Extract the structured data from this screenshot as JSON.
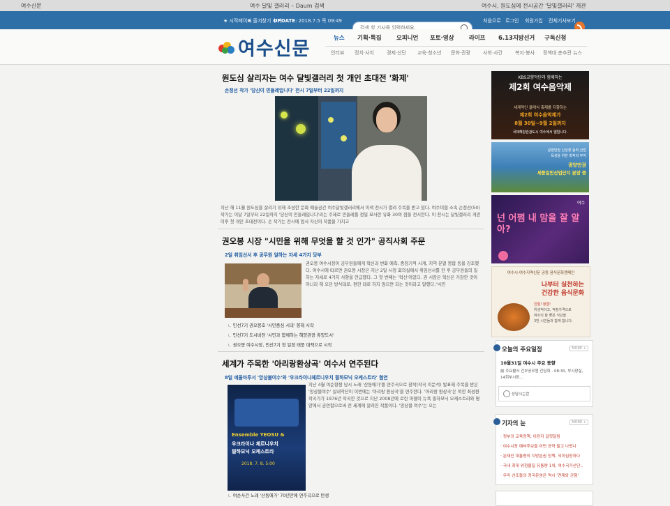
{
  "browser": {
    "tabs": [
      "여수신문",
      "여수 달빛 갤러리 – Daum 검색",
      "여수시, 원도심에 전시공간 '달빛갤러리' 개관"
    ]
  },
  "topbar": {
    "start_page": "시작페이지",
    "bookmark": "즐겨찾기 추가",
    "update_label": "UPDATE",
    "update_value": ": 2018.7.5 목 09:49",
    "search_placeholder": "검색 할 기사를 입력하세요.",
    "links": [
      "처음으로",
      "로그인",
      "회원가입",
      "전체기사보기"
    ]
  },
  "site": {
    "logo_text": "여수신문",
    "nav_main": [
      "뉴스",
      "기획·특집",
      "오피니언",
      "포토·영상",
      "라이프",
      "6.13지방선거",
      "구독신청"
    ],
    "nav_sub": [
      "인터뷰",
      "정치·사치",
      "경제·산단",
      "교육·청소년",
      "문화·관광",
      "사회·사건",
      "복지·봉사",
      "정책대 춘추관 뉴스"
    ]
  },
  "articles": [
    {
      "headline": "원도심 살리자는 여수 달빛갤러리 첫 개인 초대전 '화제'",
      "subhead": "손정선 작가 '당신이 민들레입니다' 전시 7일부터 22일까지",
      "body": "지난 해 11월 원도심을 살리기 위해 조성한 문화 예술공간 여수달빛갤러리에서 이색 전시가 열려 주목을 받고 있다. 여수미협 소속 손정선(50) 작가는 이달 7일부터 22일까지 '당신이 민들레입니다'라는 주제로 민들레를 정밀 묘사한 유화 30여 점을 전시한다. 이 전시는 달빛갤러리 개관 이후 첫 개인 초대전이다. 손 작가는 전시에 앞서 자신의 작품을 가지고"
    },
    {
      "headline": "권오봉 시장 \"시민을 위해 무엇을 할 것 인가\" 공직사회 주문",
      "subhead": "2일 취임선서 후 공무원 일하는 자세 4가지 당부",
      "body": "권오봉 여수시장이 공무원들에게 혁신과 변화 예측, 중장기적 시계, 지역 분열 봉합 등을 강조했다. 여수시에 따르면 권오봉 시장은 지난 2일 시청 회의실에서 취임선서를 한 후 공무원들의 일하는 자세로 4가지 사항을 언급했다. 그 첫 번째는 '혁신'이었다. 권 시장은 혁신은 거창한 것이 아니라 해 오던 방식대로, 편한 대로 하지 않으면 되는 것이라고 말했다.\"시민",
      "related": [
        "민선7기 권오봉호 '시민중심 시대' 향해 시작",
        "민선7기 도시비전 '시민과 함께하는 해양관광 휴양도시'",
        "권오봉 여수시장, 민선7기 첫 일정 태풍 대책으로 시작"
      ]
    },
    {
      "headline": "세계가 주목한 '아리랑환상곡' 여수서 연주된다",
      "subhead": "8일 예울마루서 '앙상블여수'와 '우크라이나체르니우치 필하모닉 오케스트라' 협연",
      "body": "지난 4월 여순항쟁 당시 노래 '산동애가'를 연주곡으로 창작(작곡 이문석) 발표해 주목을 받은 '앙상블여수' 실내악단이 이번에는 '아리랑 환상곡'을 연주한다. '아리랑 환상곡'은 북한 최성환 작곡가가 1976년 작곡한 것으로 지난 2008년에 로린 마젤이 뉴욕 필하모닉 오케스트라와 평양에서 공연함으로써 전 세계에 알려진 작품이다. '앙상블 여수'는 오는",
      "related": [
        "여순사건 노래 '산동애가' 70년만에 연주곡으로 탄생"
      ],
      "poster": {
        "line1": "Ensemble YEOSU &",
        "line2": "우크라이나 체르니우치",
        "line3": "필하모닉 오케스트라",
        "date": "2018. 7. 8. 5:00"
      }
    }
  ],
  "sidebar": {
    "banner1": {
      "top": "KBS교향악단과 함께하는",
      "title": "제2회 여수음악제",
      "l1": "세계적인 클래식 축제를 지향하는",
      "l2": "제2회 여수음악제가",
      "l3": "8월 30일~9월 2일까지",
      "l4": "국제해양관광도시 여수에서 열립니다."
    },
    "banner2": {
      "l1": "광양만권 신성장 동력 산업",
      "l2": "육성을 위한 최적의 부지",
      "l3": "광양만권",
      "l4": "세풍일반산업단지 분양 중"
    },
    "banner3": {
      "brand": "여수",
      "title": "넌 어쩜 내 맘을 잘 알아?"
    },
    "banner4": {
      "top": "여수시-여수지역신문 공동 음식문화캠페인",
      "l1": "나부터 실천하는",
      "l2": "건강한 음식문화",
      "l3": "친절! 청결!",
      "l4": "위생적이고, 적정가격으로",
      "l5": "여수의 참 좋은 식단을",
      "l6": "3만 시민들과 함께 합니다."
    },
    "schedule": {
      "title": "오늘의 주요일정",
      "more": "MORE +",
      "date": "10월31일 여수시 주요 동향",
      "item": "前 주요활사 간부공무원 간담회 - 08:30, 부시장실, 14회부시장..."
    },
    "widget_label": "상담시는란",
    "reporter": {
      "title": "기자의 눈",
      "more": "MORE +",
      "items": [
        "정부의 교육정책, 이런지 걸핏달림",
        "여수시장 예비후보들 어떤 공약 들고 나왔나",
        "문재인 대통령의 지방분권 정책, 의미심장하다",
        "국내 최대 위험물질 유통량 1위, 여수국가산단..",
        "우리 선조들의 정국운영은 역시 '견제와 균형'"
      ]
    }
  },
  "colors": {
    "brand_blue": "#1b4f8c",
    "topbar": "#2f6fa7",
    "accent_red": "#c0392b",
    "link_blue": "#1d5aa0"
  }
}
